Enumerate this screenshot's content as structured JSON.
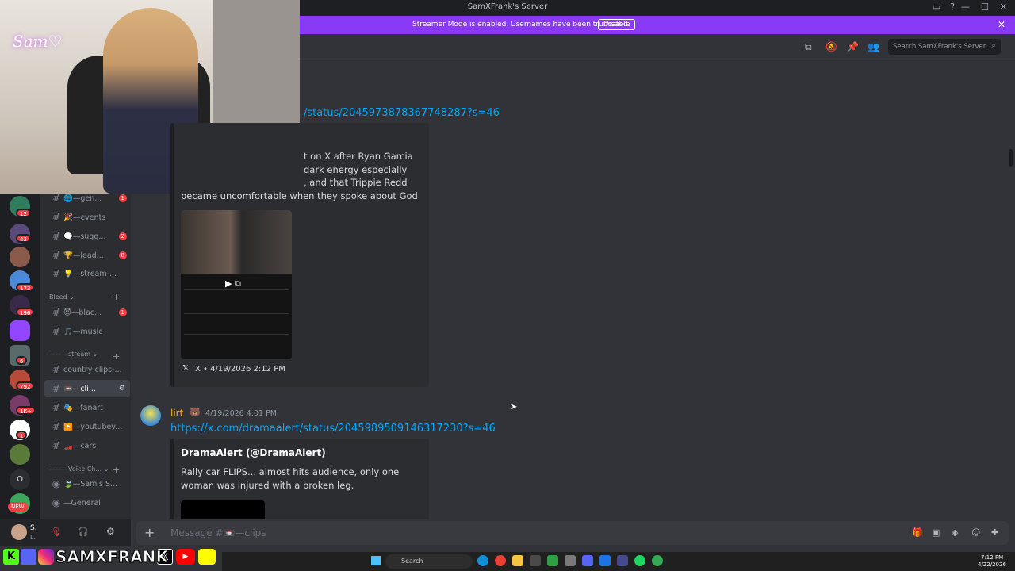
{
  "window": {
    "title": "SamXFrank's Server",
    "controls": [
      "—",
      "☐",
      "✕"
    ],
    "icons": [
      "inbox-icon",
      "help-icon"
    ]
  },
  "streamer_bar": {
    "message": "Streamer Mode is enabled. Usernames have been truncated.",
    "disable_label": "Disable",
    "color": "#8a39f5"
  },
  "topbar": {
    "search_placeholder": "Search SamXFrank's Server",
    "icons": [
      "threads-icon",
      "mute-icon",
      "pin-icon",
      "members-icon",
      "search-icon"
    ]
  },
  "servers": [
    {
      "badge": "12",
      "color": "#2f7d5c"
    },
    {
      "badge": "42",
      "color": "#5a4a7a"
    },
    {
      "badge": "",
      "color": "#8a5a4a"
    },
    {
      "badge": "173",
      "color": "#4a8ad8"
    },
    {
      "badge": "196",
      "color": "#3a2a4a"
    },
    {
      "badge": "",
      "color": "#9146ff"
    },
    {
      "badge": "6",
      "color": "#5a6a6a"
    },
    {
      "badge": "792",
      "color": "#b84a3a"
    },
    {
      "badge": "1K+",
      "color": "#7a3a6a"
    },
    {
      "badge": "1",
      "color": "#ffffff"
    },
    {
      "badge": "",
      "color": "#5a7a3a"
    },
    {
      "badge": "",
      "color": "#2b2d31",
      "letter": "O"
    },
    {
      "badge": "NEW",
      "color": "#3ba55c"
    }
  ],
  "channels": [
    {
      "name": "🌐—gen...",
      "badge": "1"
    },
    {
      "name": "🎉—events",
      "badge": ""
    },
    {
      "name": "🗨️—sugg...",
      "badge": "2"
    },
    {
      "name": "🏆—lead...",
      "badge": "8"
    },
    {
      "name": "💡—stream-...",
      "badge": ""
    },
    {
      "name": "😈—blac...",
      "badge": "1"
    },
    {
      "name": "🎵—music",
      "badge": ""
    },
    {
      "name": "country-clips-...",
      "badge": ""
    },
    {
      "name": "📼—cli...",
      "badge": ""
    },
    {
      "name": "🎭—fanart",
      "badge": ""
    },
    {
      "name": "▶️—youtubev...",
      "badge": ""
    },
    {
      "name": "🏎️—cars",
      "badge": ""
    }
  ],
  "categories": {
    "bleed": "Bleed ⌄",
    "stream": "———stream ⌄",
    "voice": "———Voice Ch... ⌄"
  },
  "voice_channels": [
    {
      "name": "🍃—Sam's S..."
    },
    {
      "name": "—General"
    }
  ],
  "user_panel": {
    "name": "S.",
    "status": "L."
  },
  "messages": {
    "first": {
      "link": "/status/2045973878367748287?s=46",
      "embed_lines": [
        "t on X after Ryan Garcia",
        "dark energy especially",
        ", and that Trippie Redd",
        "became uncomfortable when they spoke about God"
      ],
      "footer": "X • 4/19/2026 2:12 PM"
    },
    "second": {
      "author": "lirt",
      "timestamp": "4/19/2026 4:01 PM",
      "link": "https://x.com/dramaalert/status/2045989509146317230?s=46",
      "embed_title": "DramaAlert (@DramaAlert)",
      "embed_lines": [
        "Rally car FLIPS... almost hits audience, only one",
        "woman was injured with a broken leg."
      ]
    }
  },
  "composer": {
    "placeholder": "Message #📼—clips",
    "icons": [
      "gift-icon",
      "gif-icon",
      "sticker-icon",
      "emoji-icon",
      "apps-icon"
    ]
  },
  "overlay": {
    "brand": "SAMXFRANK",
    "webcam_logo": "Sam♡"
  },
  "taskbar": {
    "search": "Search",
    "time": "7:12 PM",
    "date": "4/22/2026"
  }
}
